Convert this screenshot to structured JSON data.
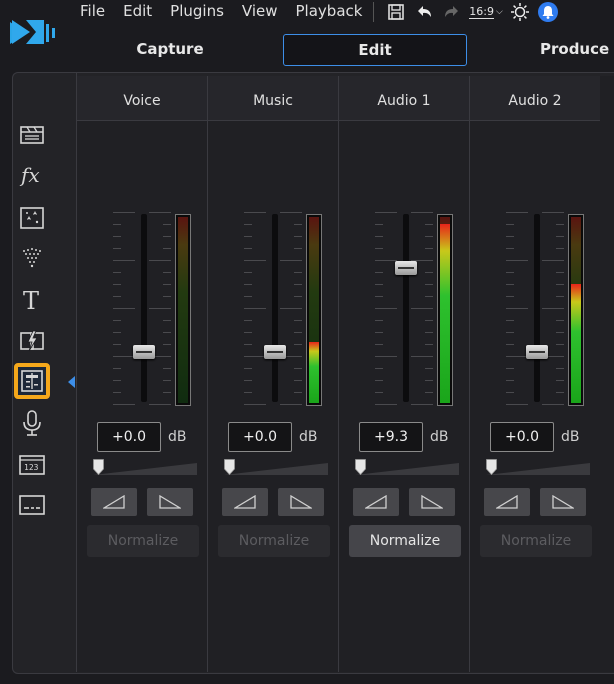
{
  "menu": [
    "File",
    "Edit",
    "Plugins",
    "View",
    "Playback"
  ],
  "toolbar": {
    "aspect_ratio": "16:9"
  },
  "modes": {
    "capture": "Capture",
    "edit": "Edit",
    "produce": "Produce",
    "active": "Edit"
  },
  "sidebar": {
    "icons": [
      "media-room-icon",
      "fx-icon",
      "particle-room-icon",
      "magic-icon",
      "title-icon",
      "transition-icon",
      "audio-mixing-icon",
      "voice-record-icon",
      "chapter-icon",
      "subtitle-icon"
    ],
    "active": "audio-mixing-icon"
  },
  "channels": [
    {
      "name": "Voice",
      "volume": "+0.0",
      "unit": "dB",
      "fader_level": 0.25,
      "meter_level": 0.0,
      "normalize": "Normalize",
      "normalize_enabled": false
    },
    {
      "name": "Music",
      "volume": "+0.0",
      "unit": "dB",
      "fader_level": 0.25,
      "meter_level": 0.33,
      "normalize": "Normalize",
      "normalize_enabled": false
    },
    {
      "name": "Audio 1",
      "volume": "+9.3",
      "unit": "dB",
      "fader_level": 0.73,
      "meter_level": 0.96,
      "normalize": "Normalize",
      "normalize_enabled": true
    },
    {
      "name": "Audio 2",
      "volume": "+0.0",
      "unit": "dB",
      "fader_level": 0.25,
      "meter_level": 0.64,
      "normalize": "Normalize",
      "normalize_enabled": false
    }
  ],
  "colors": {
    "accent": "#3d8ee8",
    "highlight": "#f5a81b",
    "meter_green": "#2ec12e",
    "meter_red": "#e8241a"
  }
}
